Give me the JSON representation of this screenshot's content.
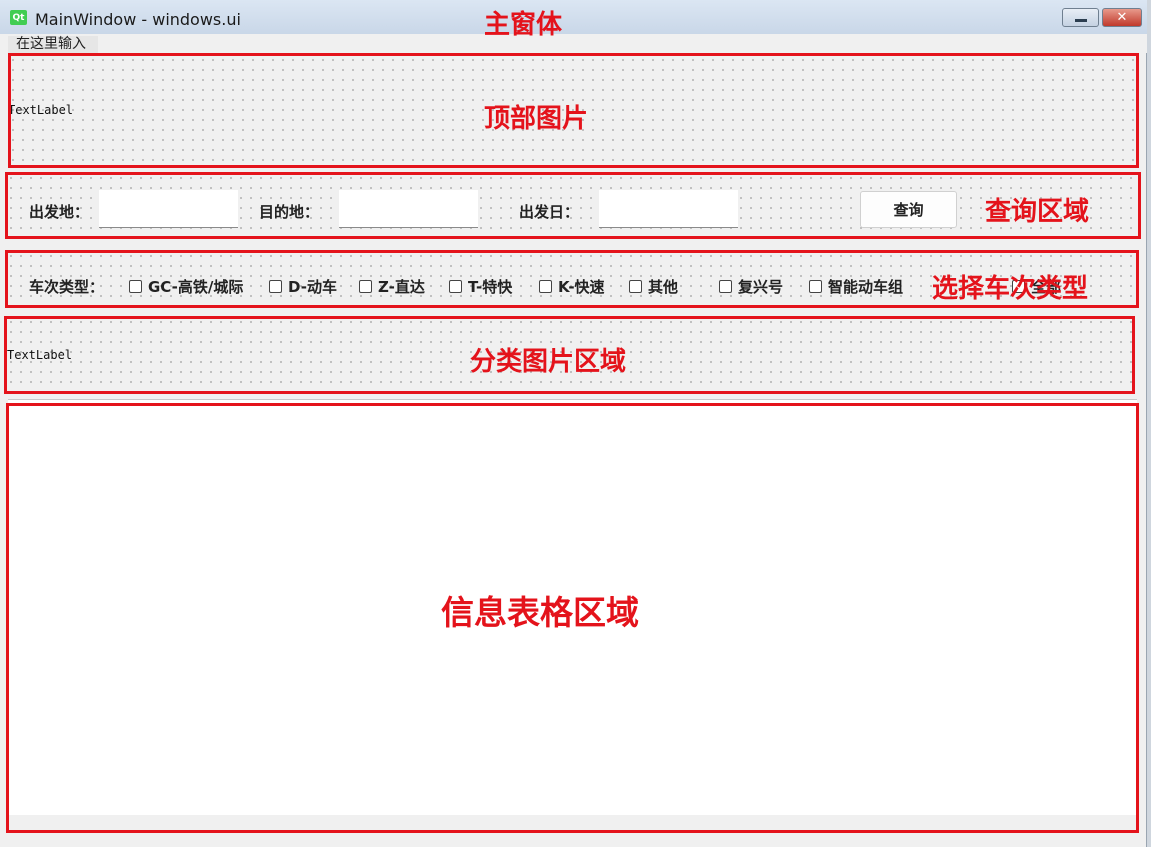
{
  "window": {
    "title": "MainWindow - windows.ui",
    "logo_text": "Qt",
    "close_symbol": "✕"
  },
  "menu": {
    "input_placeholder": "在这里输入"
  },
  "labels": {
    "top_text_label": "TextLabel",
    "category_text_label": "TextLabel"
  },
  "query": {
    "departure_label": "出发地：",
    "destination_label": "目的地：",
    "date_label": "出发日：",
    "departure_value": "",
    "destination_value": "",
    "date_value": "",
    "search_button": "查询"
  },
  "train_types": {
    "label": "车次类型：",
    "options": [
      {
        "label": "GC-高铁/城际",
        "checked": false
      },
      {
        "label": "D-动车",
        "checked": false
      },
      {
        "label": "Z-直达",
        "checked": false
      },
      {
        "label": "T-特快",
        "checked": false
      },
      {
        "label": "K-快速",
        "checked": false
      },
      {
        "label": "其他",
        "checked": false
      },
      {
        "label": "复兴号",
        "checked": false
      },
      {
        "label": "智能动车组",
        "checked": false
      },
      {
        "label": "全部",
        "checked": false
      }
    ]
  },
  "annotations": {
    "main_window": "主窗体",
    "top_image": "顶部图片",
    "query_area": "查询区域",
    "select_type": "选择车次类型",
    "category_image": "分类图片区域",
    "info_table": "信息表格区域"
  },
  "colors": {
    "annotation_red": "#e4131b",
    "qt_green": "#41cd52"
  }
}
